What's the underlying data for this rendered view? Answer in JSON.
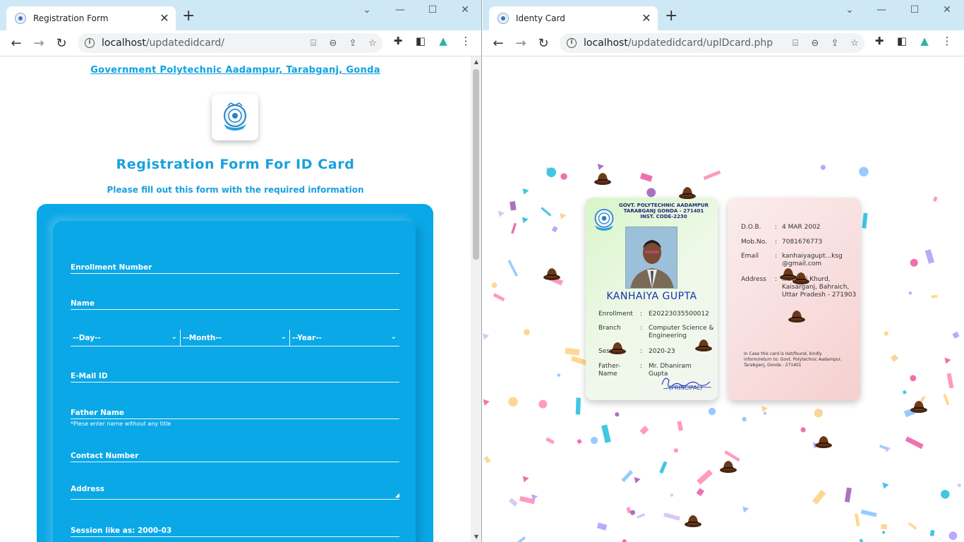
{
  "left_window": {
    "tab_title": "Registration Form",
    "url_host": "localhost",
    "url_path": "/updatedidcard/",
    "page": {
      "college_name": "Government Polytechnic Aadampur, Tarabganj, Gonda",
      "form_title": "Registration Form For ID Card",
      "form_subtitle": "Please fill out this form with the required information",
      "fields": {
        "enrollment": "Enrollment Number",
        "name": "Name",
        "day": "--Day--",
        "month": "--Month--",
        "year": "--Year--",
        "email": "E-Mail ID",
        "father": "Father Name",
        "father_hint": "*Plese enter name without any title",
        "contact": "Contact Number",
        "address": "Address",
        "session": "Session like as: 2000-03"
      }
    }
  },
  "right_window": {
    "tab_title": "Identy Card",
    "url_host": "localhost",
    "url_path": "/updatedidcard/uplDcard.php",
    "card_front": {
      "header_line1": "GOVT. POLYTECHNIC AADAMPUR",
      "header_line2": "TARABGANJ GONDA - 271401",
      "header_line3": "INST. CODE-2230",
      "name": "KANHAIYA GUPTA",
      "enrollment_label": "Enrollment",
      "enrollment_value": "E20223035500012",
      "branch_label": "Branch",
      "branch_value": "Computer Science & Engineering",
      "session_label": "Session",
      "session_value": "2020-23",
      "father_label": "Father-Name",
      "father_value": "Mr. Dhaniram Gupta",
      "colon": ":",
      "principal": "(PRINCIPAL)"
    },
    "card_back": {
      "dob_label": "D.O.B.",
      "dob_value": "4 MAR 2002",
      "mob_label": "Mob.No.",
      "mob_value": "7081676773",
      "email_label": "Email",
      "email_value": "kanhaiyagupt...ksg @gmail.com",
      "address_label": "Address",
      "address_value": "...sehari Khurd, Kaisarganj, Bahraich, Uttar Pradesh - 271903",
      "colon": ":",
      "note": "In Case this card is lost/found, kindly inform/return to: Govt. Polytechnic Aadampur, Tarabganj, Gonda - 271401"
    }
  },
  "colors": {
    "tabstrip": "#cfe8f6",
    "accent": "#18a0e0",
    "form_bg": "#0aa8e6",
    "card_name": "#1a2fb0"
  },
  "icons": [
    "close-icon",
    "plus-icon",
    "minimize-icon",
    "maximize-icon",
    "back-icon",
    "forward-icon",
    "reload-icon",
    "info-icon",
    "translate-icon",
    "zoom-icon",
    "share-icon",
    "star-icon",
    "extensions-icon",
    "sidepanel-icon",
    "profile-icon",
    "menu-icon",
    "hat-icon"
  ]
}
